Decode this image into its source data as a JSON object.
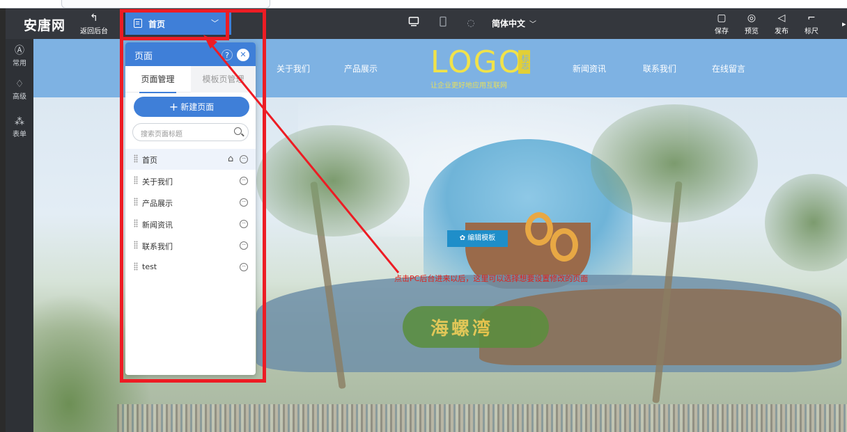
{
  "app": {
    "brand": "安唐网",
    "back_label": "返回后台",
    "page_selector": "首页",
    "language": "简体中文",
    "actions": [
      {
        "label": "保存",
        "icon": "save-icon",
        "glyph": "▢"
      },
      {
        "label": "预览",
        "icon": "eye-icon",
        "glyph": "◎"
      },
      {
        "label": "发布",
        "icon": "send-icon",
        "glyph": "◁"
      },
      {
        "label": "标尺",
        "icon": "ruler-icon",
        "glyph": "⌐"
      }
    ]
  },
  "sidebar": {
    "items": [
      {
        "label": "常用",
        "icon": "common-icon",
        "glyph": "Ⓐ"
      },
      {
        "label": "高级",
        "icon": "diamond-icon",
        "glyph": "♢"
      },
      {
        "label": "表单",
        "icon": "form-icon",
        "glyph": "⁂"
      }
    ]
  },
  "site": {
    "nav_left": [
      "关于我们",
      "产品展示"
    ],
    "nav_right": [
      "新闻资讯",
      "联系我们",
      "在线留言"
    ],
    "logo_text": "LOGO",
    "logo_mark": "标志",
    "slogan": "让企业更好地应用互联网",
    "edit_button": "编辑模板",
    "sign_text": "海螺湾"
  },
  "panel": {
    "title": "页面",
    "help": "?",
    "tabs": [
      "页面管理",
      "模板页管理"
    ],
    "new_button": "新建页面",
    "search_placeholder": "搜索页面标题",
    "pages": [
      "首页",
      "关于我们",
      "产品展示",
      "新闻资讯",
      "联系我们",
      "test"
    ]
  },
  "annotation": "点击PC后台进来以后，这里可以选择想要设置修改的页面",
  "colors": {
    "accent": "#3f7fd8",
    "highlight": "#ed1c24",
    "appbar": "#34373d",
    "site_header": "#7eb2e3"
  }
}
